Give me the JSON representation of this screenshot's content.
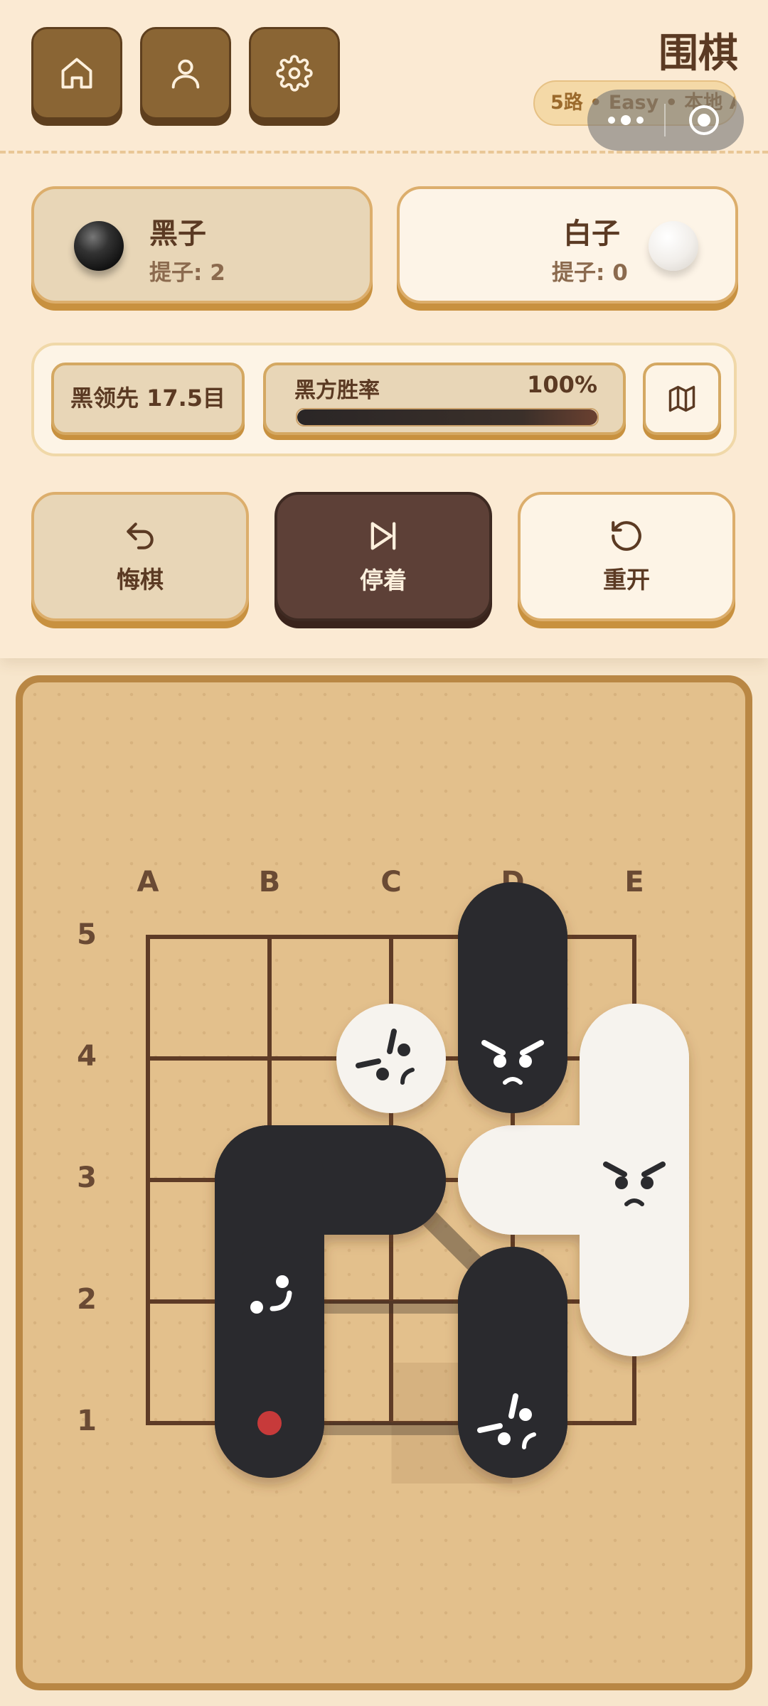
{
  "header": {
    "title": "围棋",
    "subtitle": "5路 • Easy • 本地 AI",
    "buttons": [
      "home",
      "profile",
      "settings"
    ]
  },
  "players": {
    "black": {
      "name": "黑子",
      "captures": "提子: 2"
    },
    "white": {
      "name": "白子",
      "captures": "提子: 0"
    }
  },
  "status": {
    "lead": "黑领先 17.5目",
    "win_label": "黑方胜率",
    "win_value": "100%",
    "win_fraction": 1.0
  },
  "actions": {
    "undo": "悔棋",
    "pass": "停着",
    "restart": "重开"
  },
  "board": {
    "size": 5,
    "columns": [
      "A",
      "B",
      "C",
      "D",
      "E"
    ],
    "rows": [
      "5",
      "4",
      "3",
      "2",
      "1"
    ],
    "black_groups": [
      {
        "points": [
          "D5",
          "D4"
        ],
        "face": "angry"
      },
      {
        "points": [
          "C3",
          "B3",
          "B2",
          "B1"
        ],
        "face": "dizzy"
      },
      {
        "points": [
          "D2",
          "D1"
        ],
        "face": "scared"
      }
    ],
    "white_groups": [
      {
        "points": [
          "C4"
        ],
        "face": "scared"
      },
      {
        "points": [
          "E4",
          "E3",
          "E2",
          "D3"
        ],
        "face": "angry"
      }
    ],
    "last_move": "B1",
    "colors": {
      "black_stone": "#2b2b2e",
      "white_stone": "#f6f3ee",
      "last_move_marker": "#c73a3a",
      "grid": "#5e3b26"
    }
  }
}
